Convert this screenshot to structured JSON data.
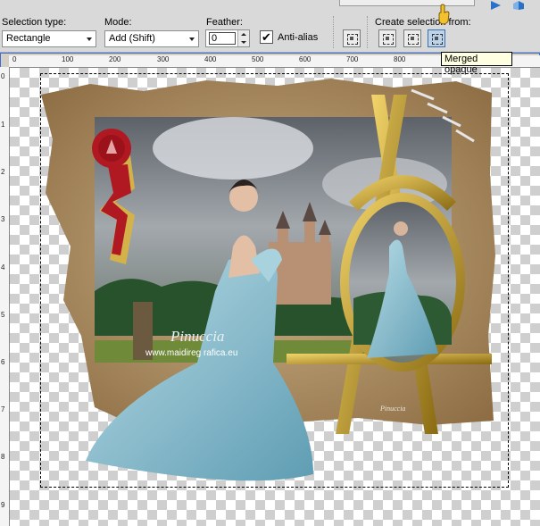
{
  "toolbar": {
    "selection_type_label": "Selection type:",
    "selection_type_value": "Rectangle",
    "mode_label": "Mode:",
    "mode_value": "Add (Shift)",
    "feather_label": "Feather:",
    "feather_value": "0",
    "antialias_label": "Anti-alias",
    "antialias_checked": true,
    "create_selection_label": "Create selection from:"
  },
  "tooltip": {
    "text": "Merged opaque"
  },
  "ruler": {
    "h_labels": [
      "0",
      "100",
      "200",
      "300",
      "400",
      "500",
      "600",
      "700",
      "800"
    ],
    "v_labels": [
      "0",
      "1",
      "2",
      "3",
      "4",
      "5",
      "6",
      "7",
      "8",
      "9"
    ]
  },
  "artwork": {
    "watermark_title": "Pinuccia",
    "watermark_url": "www.maidireg rafica.eu",
    "small_watermark_title": "Pinuccia",
    "colors": {
      "parchment": "#b89a6c",
      "gown": "#8fc0cf",
      "gold": "#c9a227",
      "seal": "#b01822",
      "accent": "#3b6fd6"
    }
  }
}
